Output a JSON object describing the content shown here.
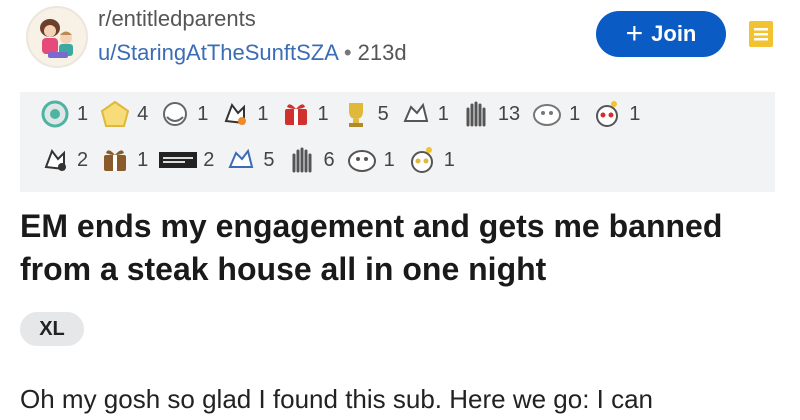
{
  "post": {
    "subreddit": "r/entitledparents",
    "author": "u/StaringAtTheSunftSZA",
    "separator": "•",
    "age": "213d",
    "join_label": "Join",
    "join_icon": "plus-icon",
    "title": "EM ends my engagement and gets me banned from a steak house all in one night",
    "flair": "XL",
    "body_preview": "Oh my gosh so glad I found this sub. Here we go: I can"
  },
  "awards": {
    "row1": [
      {
        "icon": "silver-award-icon",
        "count": "1",
        "color": "#4fb3a3"
      },
      {
        "icon": "gold-award-icon",
        "count": "4",
        "color": "#e0b83a"
      },
      {
        "icon": "hugz-award-icon",
        "count": "1",
        "color": "#666666"
      },
      {
        "icon": "wholesome-award-icon",
        "count": "1",
        "color": "#f08a24"
      },
      {
        "icon": "gift-award-icon",
        "count": "1",
        "color": "#d0312d"
      },
      {
        "icon": "trophy-award-icon",
        "count": "5",
        "color": "#e0b83a"
      },
      {
        "icon": "bless-up-award-icon",
        "count": "1",
        "color": "#555555"
      },
      {
        "icon": "clapping-award-icon",
        "count": "13",
        "color": "#555555"
      },
      {
        "icon": "face-award-icon",
        "count": "1",
        "color": "#777777"
      },
      {
        "icon": "snoo-award-icon",
        "count": "1",
        "color": "#d0312d"
      }
    ],
    "row2": [
      {
        "icon": "panda-award-icon",
        "count": "2",
        "color": "#333333"
      },
      {
        "icon": "bear-award-icon",
        "count": "1",
        "color": "#8a5a2b"
      },
      {
        "icon": "text-award-icon",
        "count": "2",
        "color": "#222222"
      },
      {
        "icon": "snoo-helmet-award-icon",
        "count": "5",
        "color": "#3a6db5"
      },
      {
        "icon": "snoo-face-award-icon",
        "count": "6",
        "color": "#555555"
      },
      {
        "icon": "snoo-love-award-icon",
        "count": "1",
        "color": "#555555"
      },
      {
        "icon": "sunglasses-award-icon",
        "count": "1",
        "color": "#e0b83a"
      }
    ]
  }
}
